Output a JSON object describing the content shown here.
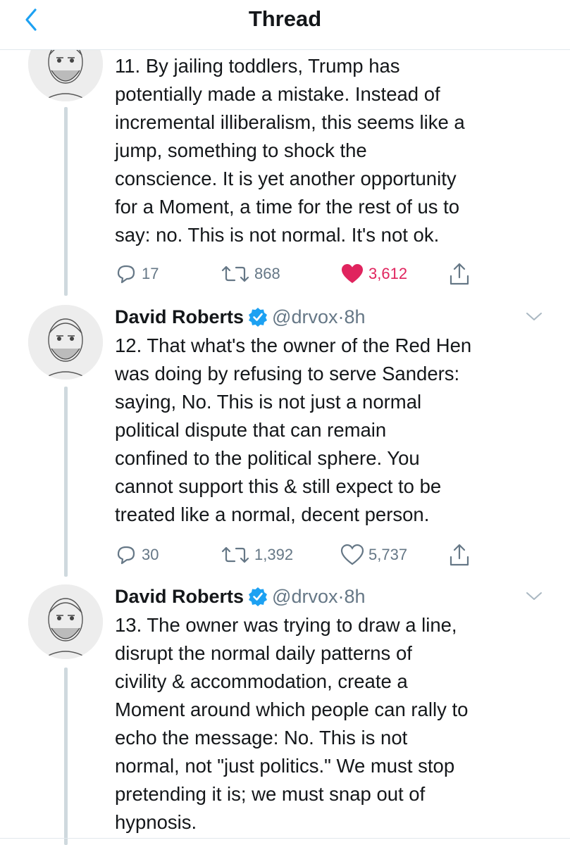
{
  "header": {
    "title": "Thread"
  },
  "tweets": [
    {
      "text": "11. By jailing toddlers, Trump has\npotentially made a mistake. Instead of\nincremental illiberalism, this seems like a\njump, something to shock the\nconscience. It is yet another opportunity\nfor a Moment, a time for the rest of us to\nsay: no. This is not normal. It's not ok.",
      "replies": "17",
      "retweets": "868",
      "likes": "3,612",
      "liked": true
    },
    {
      "name": "David Roberts",
      "handle": "@drvox",
      "dot": "·",
      "time": "8h",
      "text": "12. That what's the owner of the Red Hen\nwas doing by refusing to serve Sanders:\nsaying, No. This is not just a normal\npolitical dispute that can remain\nconfined to the political sphere. You\ncannot support this & still expect to be\ntreated like a normal, decent person.",
      "replies": "30",
      "retweets": "1,392",
      "likes": "5,737",
      "liked": false
    },
    {
      "name": "David Roberts",
      "handle": "@drvox",
      "dot": "·",
      "time": "8h",
      "text": "13. The owner was trying to draw a line,\ndisrupt the normal daily patterns of\ncivility & accommodation, create a\nMoment around which people can rally to\necho the message: No. This is not\nnormal, not \"just politics.\" We must stop\npretending it is; we must snap out of\nhypnosis."
    }
  ],
  "colors": {
    "accent": "#1da1f2",
    "like": "#e0245e",
    "muted": "#657786",
    "text": "#14171a",
    "line": "#cfd9de"
  },
  "icons": [
    "back-chevron-icon",
    "verified-badge-icon",
    "reply-icon",
    "retweet-icon",
    "like-icon",
    "share-icon",
    "chevron-down-icon"
  ]
}
